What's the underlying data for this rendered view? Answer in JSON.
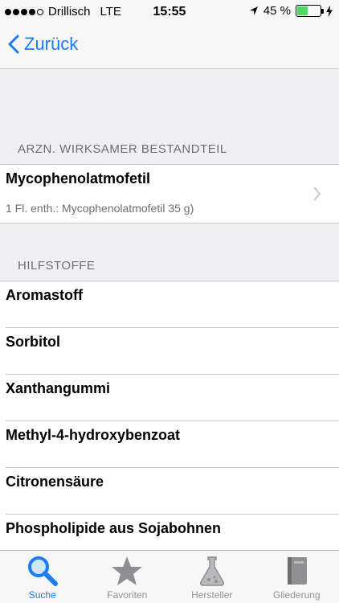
{
  "status_bar": {
    "carrier": "Drillisch",
    "network": "LTE",
    "time": "15:55",
    "battery_text": "45 %",
    "battery_level": 0.45
  },
  "nav": {
    "back_label": "Zurück"
  },
  "active_ingredient": {
    "header": "ARZN. WIRKSAMER BESTANDTEIL",
    "title": "Mycophenolatmofetil",
    "subtitle": "1 Fl. enth.: Mycophenolatmofetil 35 g)"
  },
  "excipients": {
    "header": "HILFSTOFFE",
    "items": [
      "Aromastoff",
      "Sorbitol",
      "Xanthangummi",
      "Methyl-4-hydroxybenzoat",
      "Citronensäure",
      "Phospholipide aus Sojabohnen"
    ]
  },
  "tabs": [
    {
      "label": "Suche",
      "icon": "search-icon",
      "active": true
    },
    {
      "label": "Favoriten",
      "icon": "star-icon",
      "active": false
    },
    {
      "label": "Hersteller",
      "icon": "flask-icon",
      "active": false
    },
    {
      "label": "Gliederung",
      "icon": "book-icon",
      "active": false
    }
  ],
  "colors": {
    "accent": "#1b7cf0",
    "inactive_tab": "#929292",
    "battery": "#4cd964"
  }
}
